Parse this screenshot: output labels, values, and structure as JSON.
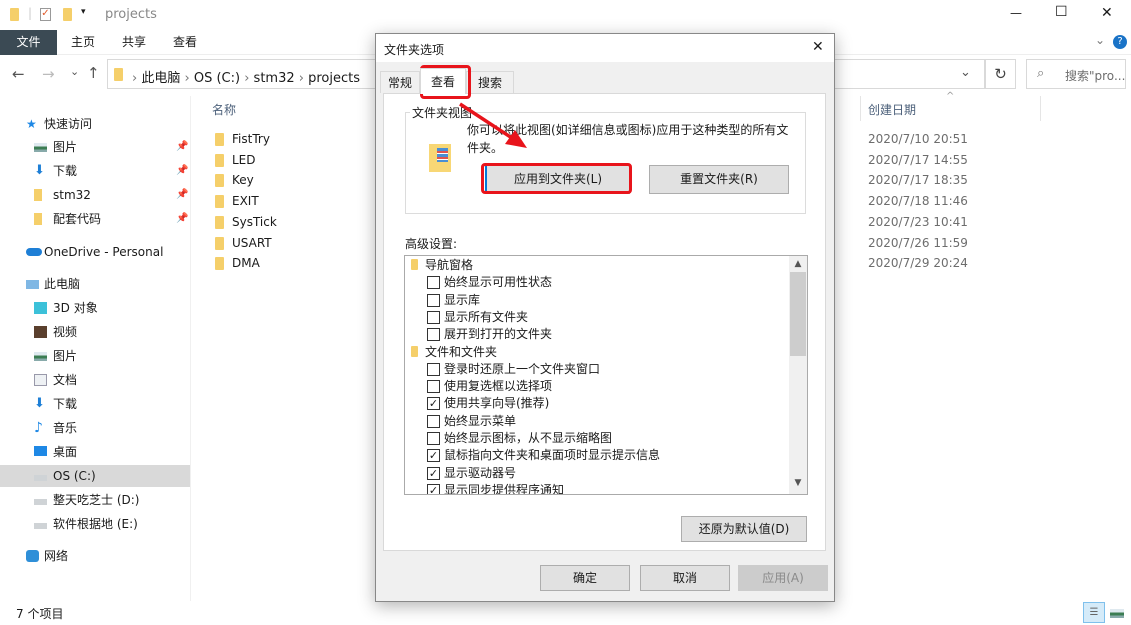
{
  "window": {
    "title": "projects",
    "min": "—",
    "max": "☐",
    "close": "✕"
  },
  "ribbon": {
    "tabs": [
      "文件",
      "主页",
      "共享",
      "查看"
    ],
    "help": "?",
    "expand": "⌄"
  },
  "address": {
    "back": "←",
    "forward": "→",
    "recent": "⌄",
    "up": "↑",
    "crumbs": [
      "此电脑",
      "OS (C:)",
      "stm32",
      "projects"
    ],
    "sep": "›",
    "dropdown": "⌄",
    "refresh": "↻",
    "search_placeholder": "搜索\"pro..."
  },
  "columns": {
    "name": "名称",
    "created": "创建日期"
  },
  "sidebar": {
    "items": [
      {
        "label": "快速访问",
        "icon": "star-icon",
        "indent": 0,
        "pinned": false
      },
      {
        "label": "图片",
        "icon": "pictures-icon",
        "indent": 1,
        "pinned": true
      },
      {
        "label": "下载",
        "icon": "download-icon",
        "indent": 1,
        "pinned": true
      },
      {
        "label": "stm32",
        "icon": "folder-icon",
        "indent": 1,
        "pinned": true
      },
      {
        "label": "配套代码",
        "icon": "folder-icon",
        "indent": 1,
        "pinned": true
      },
      {
        "label": "OneDrive - Personal",
        "icon": "cloud-icon",
        "indent": 0,
        "pinned": false
      },
      {
        "label": "此电脑",
        "icon": "computer-icon",
        "indent": 0,
        "pinned": false
      },
      {
        "label": "3D 对象",
        "icon": "cube-icon",
        "indent": 1,
        "pinned": false
      },
      {
        "label": "视频",
        "icon": "video-icon",
        "indent": 1,
        "pinned": false
      },
      {
        "label": "图片",
        "icon": "pictures-icon",
        "indent": 1,
        "pinned": false
      },
      {
        "label": "文档",
        "icon": "document-icon",
        "indent": 1,
        "pinned": false
      },
      {
        "label": "下载",
        "icon": "download-icon",
        "indent": 1,
        "pinned": false
      },
      {
        "label": "音乐",
        "icon": "music-icon",
        "indent": 1,
        "pinned": false
      },
      {
        "label": "桌面",
        "icon": "desktop-icon",
        "indent": 1,
        "pinned": false
      },
      {
        "label": "OS (C:)",
        "icon": "drive-icon",
        "indent": 1,
        "pinned": false,
        "selected": true
      },
      {
        "label": "整天吃芝士 (D:)",
        "icon": "drive-icon",
        "indent": 1,
        "pinned": false
      },
      {
        "label": "软件根据地 (E:)",
        "icon": "drive-icon",
        "indent": 1,
        "pinned": false
      },
      {
        "label": "网络",
        "icon": "network-icon",
        "indent": 0,
        "pinned": false
      }
    ]
  },
  "files": [
    {
      "name": "FistTry",
      "created": "2020/7/10 20:51"
    },
    {
      "name": "LED",
      "created": "2020/7/17 14:55"
    },
    {
      "name": "Key",
      "created": "2020/7/17 18:35"
    },
    {
      "name": "EXIT",
      "created": "2020/7/18 11:46"
    },
    {
      "name": "SysTick",
      "created": "2020/7/23 10:41"
    },
    {
      "name": "USART",
      "created": "2020/7/26 11:59"
    },
    {
      "name": "DMA",
      "created": "2020/7/29 20:24"
    }
  ],
  "status": {
    "count": "7 个项目"
  },
  "dialog": {
    "title": "文件夹选项",
    "close": "✕",
    "tabs": [
      "常规",
      "查看",
      "搜索"
    ],
    "active_tab": 1,
    "group_title": "文件夹视图",
    "group_text": "你可以将此视图(如详细信息或图标)应用于这种类型的所有文件夹。",
    "apply_folders": "应用到文件夹(L)",
    "reset_folders": "重置文件夹(R)",
    "advanced_label": "高级设置:",
    "tree": [
      {
        "type": "category",
        "label": "导航窗格"
      },
      {
        "type": "checkbox",
        "label": "始终显示可用性状态",
        "checked": false
      },
      {
        "type": "checkbox",
        "label": "显示库",
        "checked": false
      },
      {
        "type": "checkbox",
        "label": "显示所有文件夹",
        "checked": false
      },
      {
        "type": "checkbox",
        "label": "展开到打开的文件夹",
        "checked": false
      },
      {
        "type": "category",
        "label": "文件和文件夹"
      },
      {
        "type": "checkbox",
        "label": "登录时还原上一个文件夹窗口",
        "checked": false
      },
      {
        "type": "checkbox",
        "label": "使用复选框以选择项",
        "checked": false
      },
      {
        "type": "checkbox",
        "label": "使用共享向导(推荐)",
        "checked": true
      },
      {
        "type": "checkbox",
        "label": "始终显示菜单",
        "checked": false
      },
      {
        "type": "checkbox",
        "label": "始终显示图标，从不显示缩略图",
        "checked": false
      },
      {
        "type": "checkbox",
        "label": "鼠标指向文件夹和桌面项时显示提示信息",
        "checked": true
      },
      {
        "type": "checkbox",
        "label": "显示驱动器号",
        "checked": true
      },
      {
        "type": "checkbox",
        "label": "显示同步提供程序通知",
        "checked": true
      }
    ],
    "restore_defaults": "还原为默认值(D)",
    "ok": "确定",
    "cancel": "取消",
    "apply": "应用(A)"
  },
  "colors": {
    "accent_file_tab": "#3b4a54",
    "annotation_red": "#e8141b",
    "selected": "#d9d9d9"
  }
}
